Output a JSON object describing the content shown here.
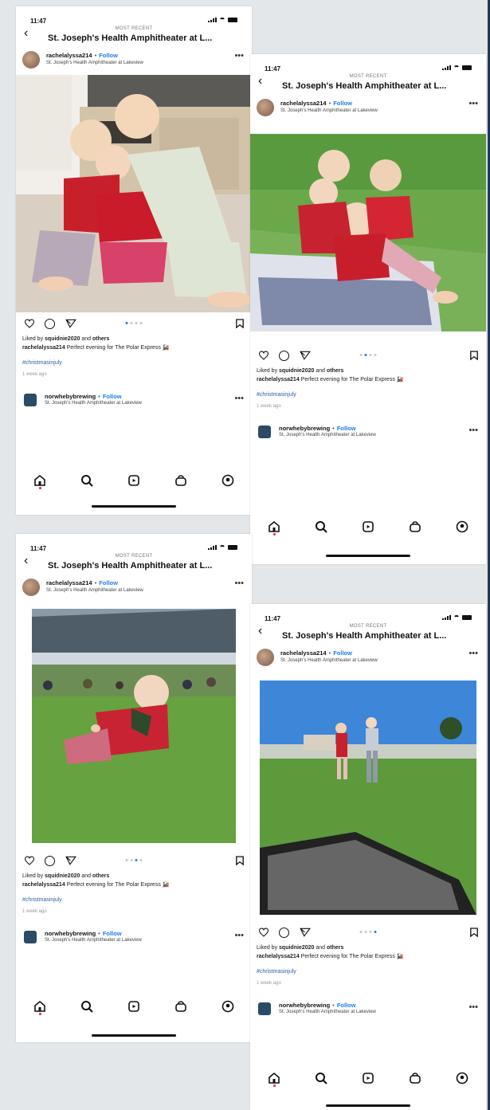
{
  "status": {
    "time": "11:47"
  },
  "header": {
    "kicker": "MOST RECENT",
    "title": "St. Joseph's Health Amphitheater at L..."
  },
  "post": {
    "username": "rachelalyssa214",
    "separator": "•",
    "follow": "Follow",
    "location": "St. Joseph's Health Amphitheater at Lakeview",
    "liked_prefix": "Liked by",
    "liked_user": "squidnie2020",
    "liked_and": "and",
    "liked_others": "others",
    "caption_user": "rachelalyssa214",
    "caption_text": "Perfect evening for The Polar Express",
    "hashtag": "#christmasinjuly",
    "time_ago": "1 week ago"
  },
  "next_post": {
    "username": "norwhebybrewing",
    "follow": "Follow",
    "location": "St. Joseph's Health Amphitheater at Lakeview"
  },
  "nav": [
    "home-icon",
    "search-icon",
    "reels-icon",
    "shop-icon",
    "profile-icon"
  ],
  "screens": [
    {
      "id": "screen-1",
      "carousel_index": 1
    },
    {
      "id": "screen-2",
      "carousel_index": 2
    },
    {
      "id": "screen-3",
      "carousel_index": 3
    },
    {
      "id": "screen-4",
      "carousel_index": 4
    }
  ],
  "colors": {
    "accent": "#1a7df2",
    "notification": "#e0245e"
  }
}
